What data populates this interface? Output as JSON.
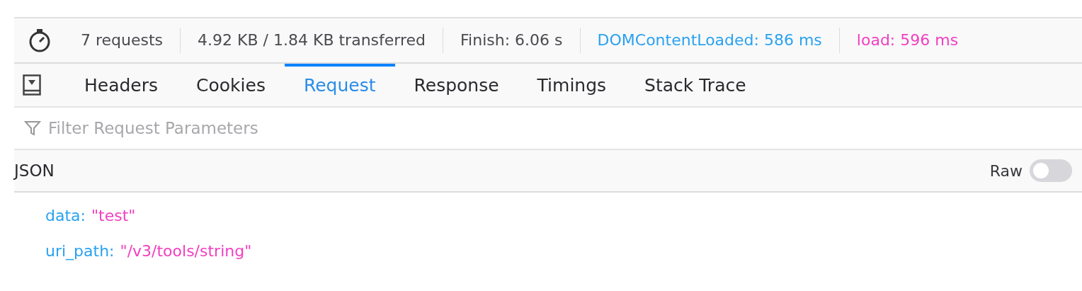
{
  "summary": [
    {
      "text": "7 requests",
      "color": "#4a4a4f"
    },
    {
      "text": "4.92 KB / 1.84 KB transferred",
      "color": "#4a4a4f"
    },
    {
      "text": "Finish: 6.06 s",
      "color": "#4a4a4f"
    },
    {
      "text": "DOMContentLoaded: 586 ms",
      "color": "#2aa2f0"
    },
    {
      "text": "load: 596 ms",
      "color": "#f23fbf"
    }
  ],
  "tabs": [
    {
      "label": "Headers",
      "selected": false
    },
    {
      "label": "Cookies",
      "selected": false
    },
    {
      "label": "Request",
      "selected": true
    },
    {
      "label": "Response",
      "selected": false
    },
    {
      "label": "Timings",
      "selected": false
    },
    {
      "label": "Stack Trace",
      "selected": false
    }
  ],
  "filter": {
    "placeholder": "Filter Request Parameters"
  },
  "section": {
    "title": "JSON",
    "raw_label": "Raw",
    "raw_on": false
  },
  "params": [
    {
      "key": "data:",
      "value": "\"test\""
    },
    {
      "key": "uri_path:",
      "value": "\"/v3/tools/string\""
    }
  ]
}
